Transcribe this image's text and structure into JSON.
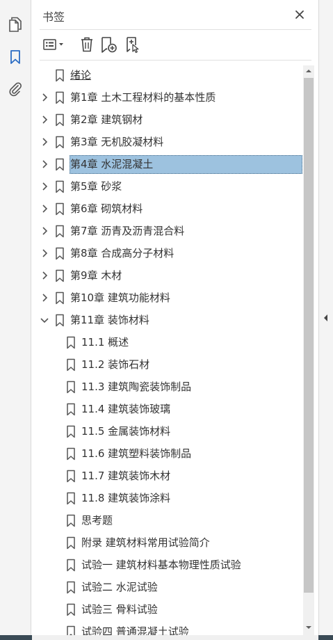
{
  "panel": {
    "title": "书签"
  },
  "icons": {
    "rail": [
      "copy-pages-icon",
      "bookmark-icon",
      "paperclip-icon"
    ],
    "toolbar": [
      "options-menu-icon",
      "delete-trash-icon",
      "new-bookmark-icon",
      "new-bookmark-from-structure-icon"
    ]
  },
  "colors": {
    "selection": "#9dc2df",
    "accent": "#2b6cc4"
  },
  "bookmarks": [
    {
      "label": "绪论",
      "level": 0,
      "toggle": "none",
      "underline": true
    },
    {
      "label": "第1章  土木工程材料的基本性质",
      "level": 0,
      "toggle": "collapsed"
    },
    {
      "label": "第2章  建筑钢材",
      "level": 0,
      "toggle": "collapsed"
    },
    {
      "label": "第3章  无机胶凝材料",
      "level": 0,
      "toggle": "collapsed"
    },
    {
      "label": "第4章  水泥混凝土",
      "level": 0,
      "toggle": "collapsed",
      "selected": true
    },
    {
      "label": "第5章  砂浆",
      "level": 0,
      "toggle": "collapsed"
    },
    {
      "label": "第6章  砌筑材料",
      "level": 0,
      "toggle": "collapsed"
    },
    {
      "label": "第7章  沥青及沥青混合料",
      "level": 0,
      "toggle": "collapsed"
    },
    {
      "label": "第8章  合成高分子材料",
      "level": 0,
      "toggle": "collapsed"
    },
    {
      "label": "第9章  木材",
      "level": 0,
      "toggle": "collapsed"
    },
    {
      "label": "第10章  建筑功能材料",
      "level": 0,
      "toggle": "collapsed"
    },
    {
      "label": "第11章  装饰材料",
      "level": 0,
      "toggle": "expanded"
    },
    {
      "label": "11.1  概述",
      "level": 1,
      "toggle": "none"
    },
    {
      "label": "11.2  装饰石材",
      "level": 1,
      "toggle": "none"
    },
    {
      "label": "11.3  建筑陶瓷装饰制品",
      "level": 1,
      "toggle": "none"
    },
    {
      "label": "11.4  建筑装饰玻璃",
      "level": 1,
      "toggle": "none"
    },
    {
      "label": "11.5  金属装饰材料",
      "level": 1,
      "toggle": "none"
    },
    {
      "label": "11.6  建筑塑料装饰制品",
      "level": 1,
      "toggle": "none"
    },
    {
      "label": "11.7  建筑装饰木材",
      "level": 1,
      "toggle": "none"
    },
    {
      "label": "11.8  建筑装饰涂料",
      "level": 1,
      "toggle": "none"
    },
    {
      "label": "思考题",
      "level": 1,
      "toggle": "none"
    },
    {
      "label": "附录  建筑材料常用试验简介",
      "level": 1,
      "toggle": "none"
    },
    {
      "label": "试验一  建筑材料基本物理性质试验",
      "level": 1,
      "toggle": "none"
    },
    {
      "label": "试验二  水泥试验",
      "level": 1,
      "toggle": "none"
    },
    {
      "label": "试验三  骨料试验",
      "level": 1,
      "toggle": "none"
    },
    {
      "label": "试验四  普通混凝土试验",
      "level": 1,
      "toggle": "none"
    }
  ]
}
